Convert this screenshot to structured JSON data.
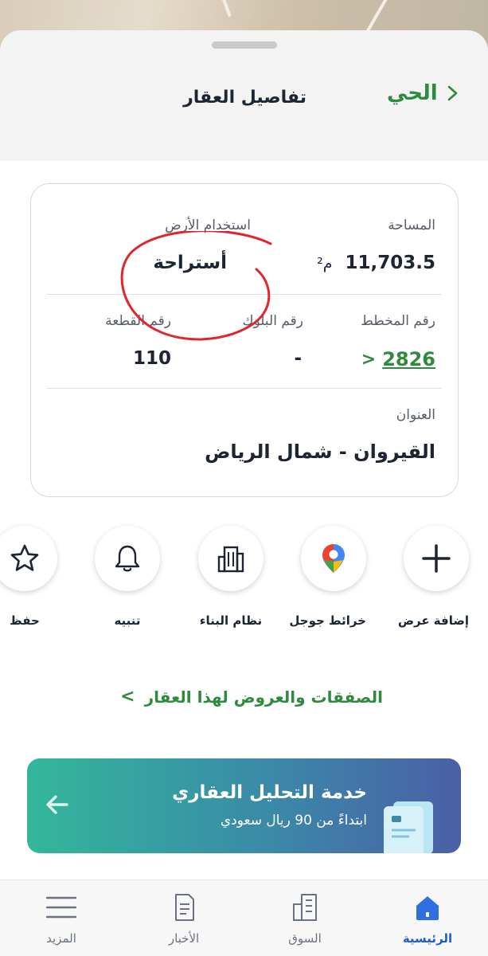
{
  "header": {
    "title": "تفاصيل العقار",
    "back_label": "الحي"
  },
  "details": {
    "area_label": "المساحة",
    "area_value": "11,703.5",
    "area_unit": "م²",
    "land_use_label": "استخدام الأرض",
    "land_use_value": "أستراحة",
    "plan_label": "رقم المخطط",
    "plan_value": "2826",
    "block_label": "رقم البلوك",
    "block_value": "-",
    "parcel_label": "رقم القطعة",
    "parcel_value": "110",
    "address_label": "العنوان",
    "address_value": "القيروان - شمال الرياض"
  },
  "actions": [
    {
      "label": "إضافة عرض",
      "icon": "plus-icon"
    },
    {
      "label": "خرائط جوجل",
      "icon": "map-pin-icon"
    },
    {
      "label": "نظام البناء",
      "icon": "building-icon"
    },
    {
      "label": "تنبيه",
      "icon": "bell-icon"
    },
    {
      "label": "حفظ",
      "icon": "star-icon"
    }
  ],
  "deals_link": "الصفقات والعروض لهذا العقار",
  "banner": {
    "title": "خدمة التحليل العقاري",
    "subtitle": "ابتداءً من 90 ريال سعودي"
  },
  "tabs": [
    {
      "label": "الرئيسية",
      "icon": "home-icon",
      "active": true
    },
    {
      "label": "السوق",
      "icon": "market-icon",
      "active": false
    },
    {
      "label": "الأخبار",
      "icon": "news-icon",
      "active": false
    },
    {
      "label": "المزيد",
      "icon": "menu-icon",
      "active": false
    }
  ],
  "colors": {
    "accent_green": "#2e8b3e",
    "active_blue": "#1c5dd6",
    "annotation_red": "#e0262b"
  }
}
